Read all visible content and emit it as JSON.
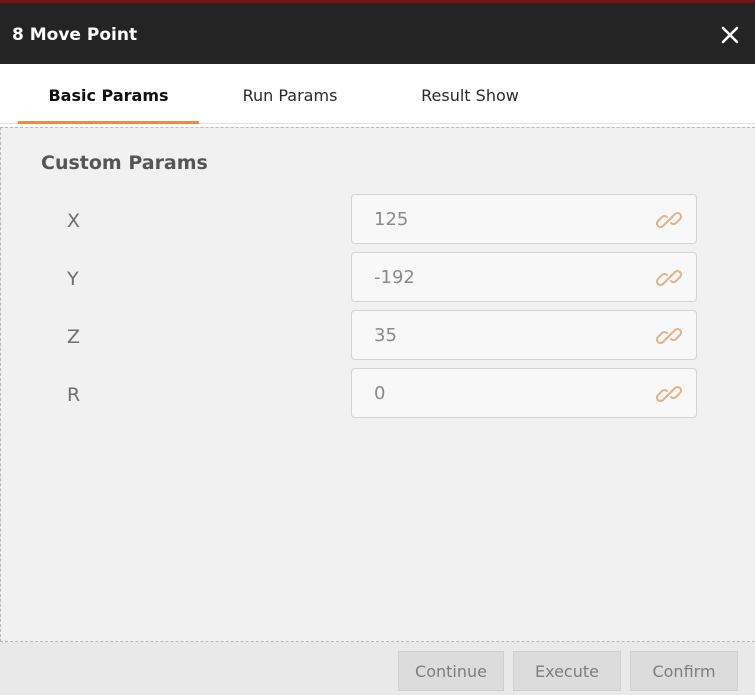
{
  "window": {
    "title": "8 Move Point",
    "close_icon": "close-icon"
  },
  "tabs": [
    {
      "label": "Basic Params",
      "active": true
    },
    {
      "label": "Run Params",
      "active": false
    },
    {
      "label": "Result Show",
      "active": false
    }
  ],
  "section": {
    "title": "Custom Params"
  },
  "params": [
    {
      "label": "X",
      "value": "125",
      "icon": "link-icon"
    },
    {
      "label": "Y",
      "value": "-192",
      "icon": "link-icon"
    },
    {
      "label": "Z",
      "value": "35",
      "icon": "link-icon"
    },
    {
      "label": "R",
      "value": "0",
      "icon": "link-icon"
    }
  ],
  "footer": {
    "continue_label": "Continue",
    "execute_label": "Execute",
    "confirm_label": "Confirm"
  },
  "colors": {
    "titlebar": "#242424",
    "accent": "#f08a3e",
    "link_icon": "#e0b58a"
  }
}
